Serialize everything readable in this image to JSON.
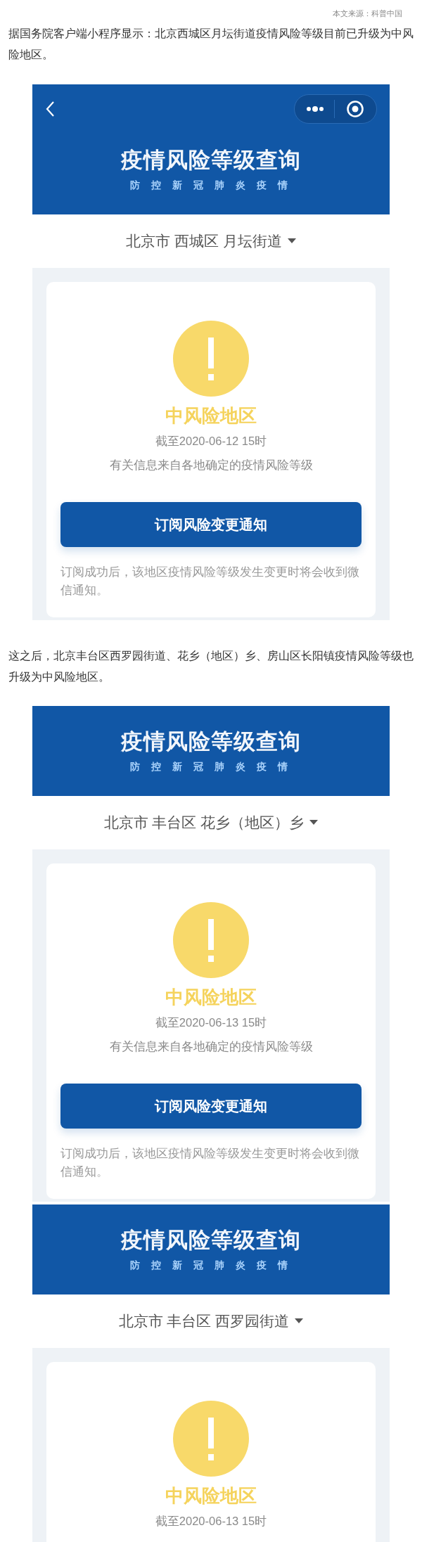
{
  "source": "本文来源：科普中国",
  "blocks": [
    {
      "kind": "paragraph",
      "text": "据国务院客户端小程序显示：北京西城区月坛街道疫情风险等级目前已升级为中风险地区。"
    },
    {
      "kind": "screenshot",
      "nav_bar": true,
      "title": "疫情风险等级查询",
      "subtitle": "防 控 新 冠 肺 炎 疫 情",
      "location": "北京市 西城区 月坛街道",
      "level_text": "中风险地区",
      "date": "截至2020-06-12 15时",
      "info": "有关信息来自各地确定的疫情风险等级",
      "button": "订阅风险变更通知",
      "note": "订阅成功后，该地区疫情风险等级发生变更时将会收到微信通知。"
    },
    {
      "kind": "paragraph",
      "text": "这之后，北京丰台区西罗园街道、花乡（地区）乡、房山区长阳镇疫情风险等级也升级为中风险地区。"
    },
    {
      "kind": "screenshot",
      "nav_bar": false,
      "title": "疫情风险等级查询",
      "subtitle": "防 控 新 冠 肺 炎 疫 情",
      "location": "北京市 丰台区 花乡（地区）乡",
      "level_text": "中风险地区",
      "date": "截至2020-06-13 15时",
      "info": "有关信息来自各地确定的疫情风险等级",
      "button": "订阅风险变更通知",
      "note": "订阅成功后，该地区疫情风险等级发生变更时将会收到微信通知。"
    },
    {
      "kind": "screenshot",
      "nav_bar": false,
      "title": "疫情风险等级查询",
      "subtitle": "防 控 新 冠 肺 炎 疫 情",
      "location": "北京市 丰台区 西罗园街道",
      "level_text": "中风险地区",
      "date": "截至2020-06-13 15时"
    }
  ]
}
